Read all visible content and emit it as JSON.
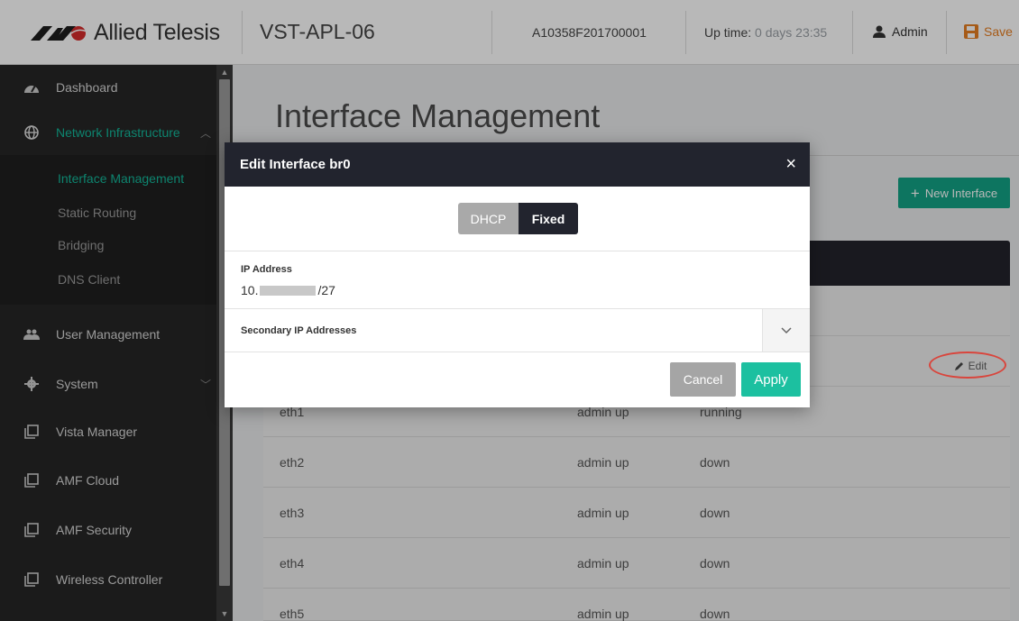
{
  "header": {
    "brand": "Allied Telesis",
    "device_name": "VST-APL-06",
    "serial": "A10358F201700001",
    "uptime_label": "Up time:",
    "uptime_value": "0 days 23:35",
    "user_label": "Admin",
    "save_label": "Save"
  },
  "sidebar": {
    "items": [
      {
        "label": "Dashboard",
        "icon": "dashboard-gauge-icon"
      },
      {
        "label": "Network Infrastructure",
        "icon": "globe-icon"
      },
      {
        "label": "User Management",
        "icon": "users-icon"
      },
      {
        "label": "System",
        "icon": "gear-icon"
      },
      {
        "label": "Vista Manager",
        "icon": "window-icon"
      },
      {
        "label": "AMF Cloud",
        "icon": "window-icon"
      },
      {
        "label": "AMF Security",
        "icon": "window-icon"
      },
      {
        "label": "Wireless Controller",
        "icon": "window-icon"
      }
    ],
    "subitems": [
      {
        "label": "Interface Management",
        "active": true
      },
      {
        "label": "Static Routing"
      },
      {
        "label": "Bridging"
      },
      {
        "label": "DNS Client"
      }
    ]
  },
  "main": {
    "title": "Interface Management",
    "new_button": "New Interface",
    "edit_label": "Edit",
    "rows": [
      {
        "name": "eth1",
        "admin": "admin up",
        "state": "running"
      },
      {
        "name": "eth2",
        "admin": "admin up",
        "state": "down"
      },
      {
        "name": "eth3",
        "admin": "admin up",
        "state": "down"
      },
      {
        "name": "eth4",
        "admin": "admin up",
        "state": "down"
      },
      {
        "name": "eth5",
        "admin": "admin up",
        "state": "down"
      }
    ]
  },
  "modal": {
    "title": "Edit Interface br0",
    "close_glyph": "×",
    "toggle": {
      "dhcp": "DHCP",
      "fixed": "Fixed",
      "selected": "Fixed"
    },
    "ip_label": "IP Address",
    "ip_prefix": "10.",
    "ip_suffix": "/27",
    "secondary_label": "Secondary IP Addresses",
    "cancel": "Cancel",
    "apply": "Apply"
  },
  "colors": {
    "accent": "#13b89a",
    "header_dark": "#22242e",
    "save_orange": "#e67e22",
    "annotation_red": "#d9453c"
  }
}
